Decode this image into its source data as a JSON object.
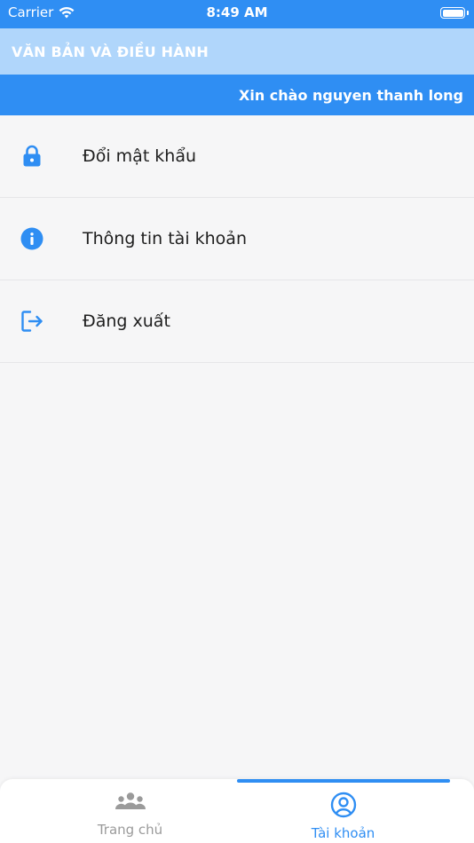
{
  "status_bar": {
    "carrier": "Carrier",
    "time": "8:49 AM"
  },
  "header": {
    "title": "VĂN BẢN VÀ ĐIỀU HÀNH"
  },
  "greeting": {
    "text": "Xin chào nguyen thanh long"
  },
  "menu": {
    "items": [
      {
        "label": "Đổi mật khẩu",
        "icon": "lock-icon"
      },
      {
        "label": "Thông tin tài khoản",
        "icon": "info-icon"
      },
      {
        "label": "Đăng xuất",
        "icon": "logout-icon"
      }
    ]
  },
  "tab_bar": {
    "tabs": [
      {
        "label": "Trang chủ",
        "icon": "people-icon",
        "active": false
      },
      {
        "label": "Tài khoản",
        "icon": "user-circle-icon",
        "active": true
      }
    ]
  },
  "colors": {
    "primary": "#2f8ef3",
    "header_light": "#b0d6fb",
    "inactive": "#9a9a9a"
  }
}
